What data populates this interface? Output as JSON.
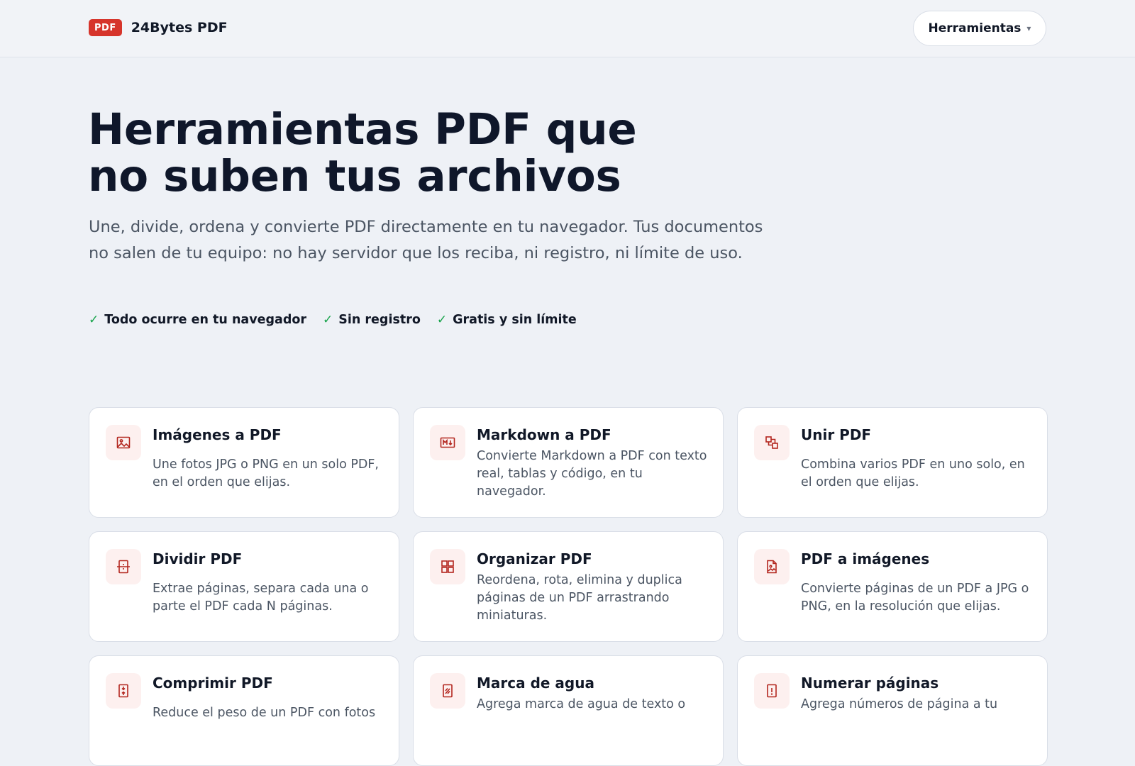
{
  "header": {
    "badge": "PDF",
    "brand": "24Bytes PDF",
    "tools_label": "Herramientas",
    "tools_caret": "▾"
  },
  "hero": {
    "title_line1": "Herramientas PDF que",
    "title_line2": "no suben tus archivos",
    "subtitle": "Une, divide, ordena y convierte PDF directamente en tu navegador. Tus documentos no salen de tu equipo: no hay servidor que los reciba, ni registro, ni límite de uso.",
    "perks": [
      {
        "check": "✓",
        "label": "Todo ocurre en tu navegador"
      },
      {
        "check": "✓",
        "label": "Sin registro"
      },
      {
        "check": "✓",
        "label": "Gratis y sin límite"
      }
    ]
  },
  "tools": [
    {
      "title": "Imágenes a PDF",
      "desc": "Une fotos JPG o PNG en un solo PDF, en el orden que elijas.",
      "icon": "image-icon"
    },
    {
      "title": "Markdown a PDF",
      "desc": "Convierte Markdown a PDF con texto real, tablas y código, en tu navegador.",
      "icon": "markdown-icon"
    },
    {
      "title": "Unir PDF",
      "desc": "Combina varios PDF en uno solo, en el orden que elijas.",
      "icon": "merge-icon"
    },
    {
      "title": "Dividir PDF",
      "desc": "Extrae páginas, separa cada una o parte el PDF cada N páginas.",
      "icon": "split-icon"
    },
    {
      "title": "Organizar PDF",
      "desc": "Reordena, rota, elimina y duplica páginas de un PDF arrastrando miniaturas.",
      "icon": "grid-icon"
    },
    {
      "title": "PDF a imágenes",
      "desc": "Convierte páginas de un PDF a JPG o PNG, en la resolución que elijas.",
      "icon": "file-image-icon"
    },
    {
      "title": "Comprimir PDF",
      "desc": "Reduce el peso de un PDF con fotos",
      "icon": "compress-icon"
    },
    {
      "title": "Marca de agua",
      "desc": "Agrega marca de agua de texto o",
      "icon": "watermark-icon"
    },
    {
      "title": "Numerar páginas",
      "desc": "Agrega números de página a tu",
      "icon": "page-number-icon"
    }
  ],
  "colors": {
    "accent": "#d6342b",
    "icon_bg": "#fdf0ef",
    "check": "#16a34a",
    "page_bg": "#eef1f6"
  }
}
